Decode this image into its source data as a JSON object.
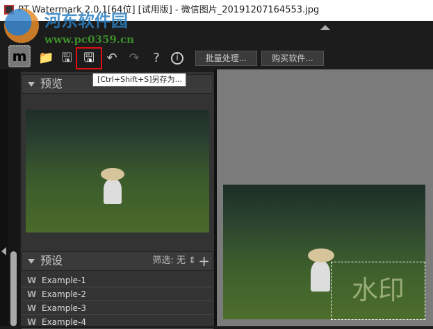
{
  "window": {
    "title": "PT Watermark 2.0.1[64位] [试用版] - 微信图片_20191207164553.jpg"
  },
  "overlay_watermark": {
    "name": "河东软件园",
    "url": "www.pc0359.cn"
  },
  "toolbar": {
    "logo": "m",
    "batch_label": "批量处理...",
    "buy_label": "购买软件...",
    "help": "?",
    "info": "i"
  },
  "tooltip": "[Ctrl+Shift+S]另存为...",
  "preview": {
    "title": "预览"
  },
  "presets": {
    "title": "预设",
    "filter_label": "筛选:",
    "filter_value": "无",
    "items": [
      {
        "label": "Example-1",
        "icon": "W"
      },
      {
        "label": "Example-2",
        "icon": "W"
      },
      {
        "label": "Example-3",
        "icon": "W"
      },
      {
        "label": "Example-4",
        "icon": "W"
      }
    ]
  },
  "canvas": {
    "watermark_text": "水印"
  }
}
